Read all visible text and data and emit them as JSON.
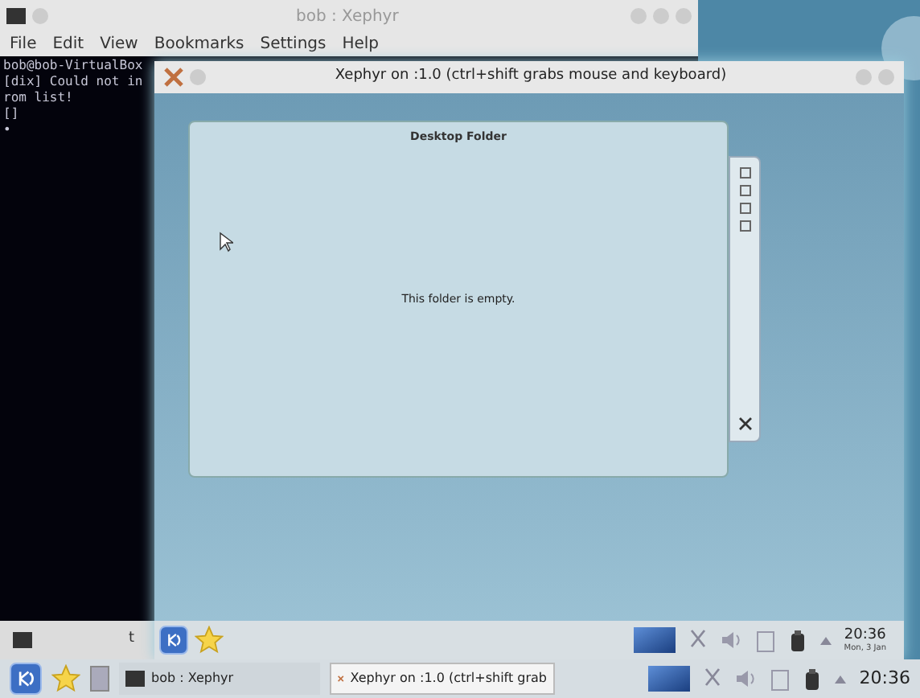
{
  "terminal_window": {
    "title": "bob : Xephyr",
    "menu": [
      "File",
      "Edit",
      "View",
      "Bookmarks",
      "Settings",
      "Help"
    ],
    "lines": [
      "bob@bob-VirtualBox",
      "[dix] Could not in",
      "rom list!",
      "[]",
      "•"
    ],
    "tab_label": "t"
  },
  "xephyr_window": {
    "title": "Xephyr on :1.0 (ctrl+shift grabs mouse and keyboard)",
    "folder_widget": {
      "title": "Desktop Folder",
      "message": "This folder is empty."
    },
    "panel": {
      "time": "20:36",
      "date": "Mon, 3 Jan"
    }
  },
  "taskbar": {
    "tasks": [
      {
        "label": "bob : Xephyr",
        "kind": "terminal",
        "selected": false
      },
      {
        "label": "Xephyr on :1.0 (ctrl+shift grab",
        "kind": "xephyr",
        "selected": true
      }
    ],
    "time": "20:36"
  }
}
